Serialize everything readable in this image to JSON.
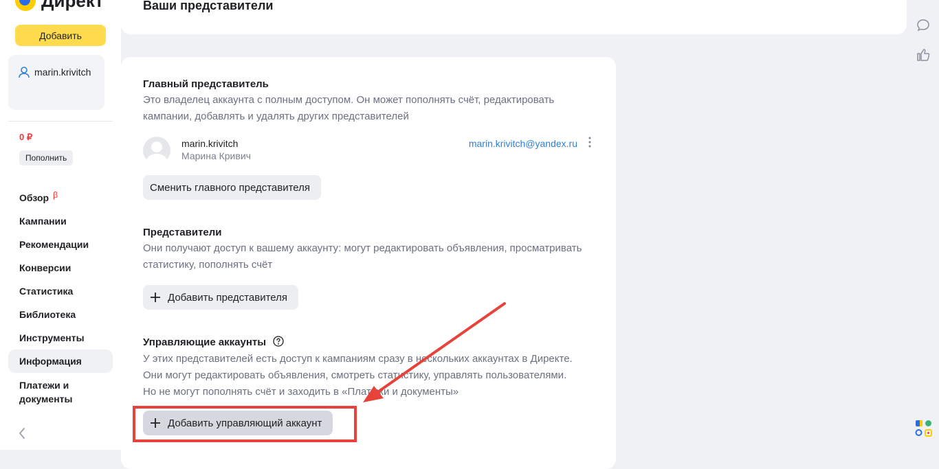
{
  "app": {
    "logo_text": "Директ"
  },
  "sidebar": {
    "add_label": "Добавить",
    "user_login": "marin.krivitch",
    "balance": "0 ₽",
    "refill_label": "Пополнить",
    "items": [
      {
        "label": "Обзор",
        "badge": "β"
      },
      {
        "label": "Кампании"
      },
      {
        "label": "Рекомендации"
      },
      {
        "label": "Конверсии"
      },
      {
        "label": "Статистика"
      },
      {
        "label": "Библиотека"
      },
      {
        "label": "Инструменты"
      },
      {
        "label": "Информация",
        "active": true
      },
      {
        "label": "Платежи и документы"
      }
    ]
  },
  "header": {
    "title": "Ваши представители"
  },
  "main": {
    "owner_section": {
      "title": "Главный представитель",
      "description": "Это владелец аккаунта с полным доступом. Он может пополнять счёт, редактировать кампании, добавлять и удалять других представителей",
      "owner": {
        "login": "marin.krivitch",
        "name": "Марина Кривич",
        "email": "marin.krivitch@yandex.ru"
      },
      "change_button": "Сменить главного представителя"
    },
    "reps_section": {
      "title": "Представители",
      "description": "Они получают доступ к вашему аккаунту: могут редактировать объявления, просматривать статистику, пополнять счёт",
      "add_button": "Добавить представителя"
    },
    "managers_section": {
      "title": "Управляющие аккаунты",
      "description": "У этих представителей есть доступ к кампаниям сразу в нескольких аккаунтах в Директе. Они могут редактировать объявления, смотреть статистику, управлять пользователями. Но не могут пополнять счёт и заходить в «Платежи и документы»",
      "add_button": "Добавить управляющий аккаунт"
    }
  },
  "colors": {
    "accent_yellow": "#ffdb4d",
    "link_blue": "#2d7fd6",
    "annotation_red": "#e8433a",
    "balance_red": "#ff3333"
  },
  "icons": {
    "user": "user-icon",
    "more": "vertical-dots-icon",
    "plus": "plus-icon",
    "help": "question-circle-icon",
    "chat": "chat-bubble-icon",
    "like": "thumb-up-icon",
    "collapse": "chevron-left-icon",
    "apps": "apps-grid-icon"
  }
}
